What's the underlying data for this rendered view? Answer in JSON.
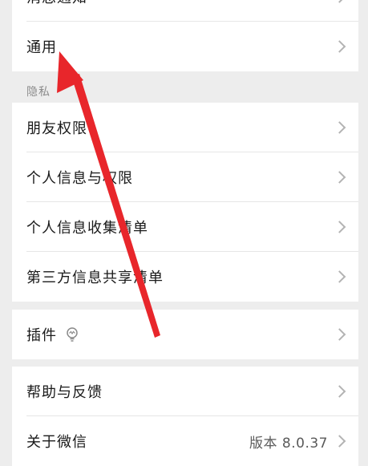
{
  "top": {
    "partial_label": "消息通知"
  },
  "general": {
    "label": "通用"
  },
  "privacy": {
    "section_title": "隐私",
    "items": [
      {
        "label": "朋友权限"
      },
      {
        "label": "个人信息与权限"
      },
      {
        "label": "个人信息收集清单"
      },
      {
        "label": "第三方信息共享清单"
      }
    ]
  },
  "plugins": {
    "label": "插件",
    "icon": "lightbulb-icon"
  },
  "help": {
    "items": [
      {
        "label": "帮助与反馈"
      },
      {
        "label": "关于微信",
        "value": "版本 8.0.37"
      }
    ]
  },
  "colors": {
    "annotation_arrow": "#e8262b"
  }
}
